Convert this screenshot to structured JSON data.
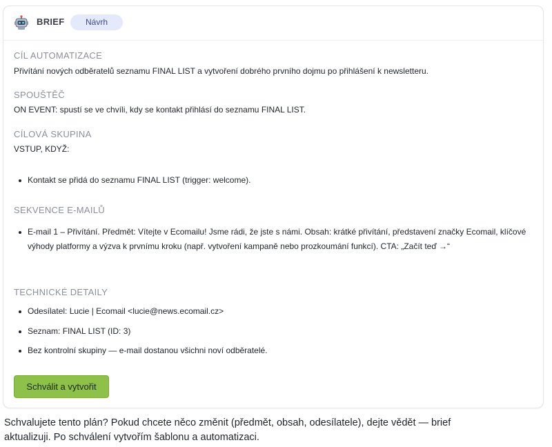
{
  "header": {
    "icon": "robot-icon",
    "title": "BRIEF",
    "badge": "Návrh"
  },
  "sections": {
    "goal": {
      "title": "CÍL AUTOMATIZACE",
      "text": "Přivítání nových odběratelů seznamu FINAL LIST a vytvoření dobrého prvního dojmu po přihlášení k newsletteru."
    },
    "trigger": {
      "title": "SPOUŠTĚČ",
      "text": "ON EVENT: spustí se ve chvíli, kdy se kontakt přihlásí do seznamu FINAL LIST."
    },
    "audience": {
      "title": "CÍLOVÁ SKUPINA",
      "text": "VSTUP, KDYŽ:",
      "items": [
        "Kontakt se přidá do seznamu FINAL LIST (trigger: welcome)."
      ]
    },
    "emails": {
      "title": "SEKVENCE E-MAILŮ",
      "items": [
        "E-mail 1 – Přivítání. Předmět: Vítejte v Ecomailu! Jsme rádi, že jste s námi. Obsah: krátké přivítání, představení značky Ecomail, klíčové výhody platformy a výzva k prvnímu kroku (např. vytvoření kampaně nebo prozkoumání funkcí). CTA: „Začít teď →“"
      ]
    },
    "technical": {
      "title": "TECHNICKÉ DETAILY",
      "items": [
        "Odesílatel: Lucie | Ecomail <lucie@news.ecomail.cz>",
        "Seznam: FINAL LIST (ID: 3)",
        "Bez kontrolní skupiny — e-mail dostanou všichni noví odběratelé."
      ]
    }
  },
  "approve_button": "Schválit a vytvořit",
  "footer": "Schvalujete tento plán? Pokud chcete něco změnit (předmět, obsah, odesílatele), dejte vědět — brief aktualizuji. Po schválení vytvořím šablonu a automatizaci.",
  "colors": {
    "badge_bg": "#e4e9fb",
    "approve_bg": "#8dc14a",
    "section_title": "#8a9099"
  }
}
